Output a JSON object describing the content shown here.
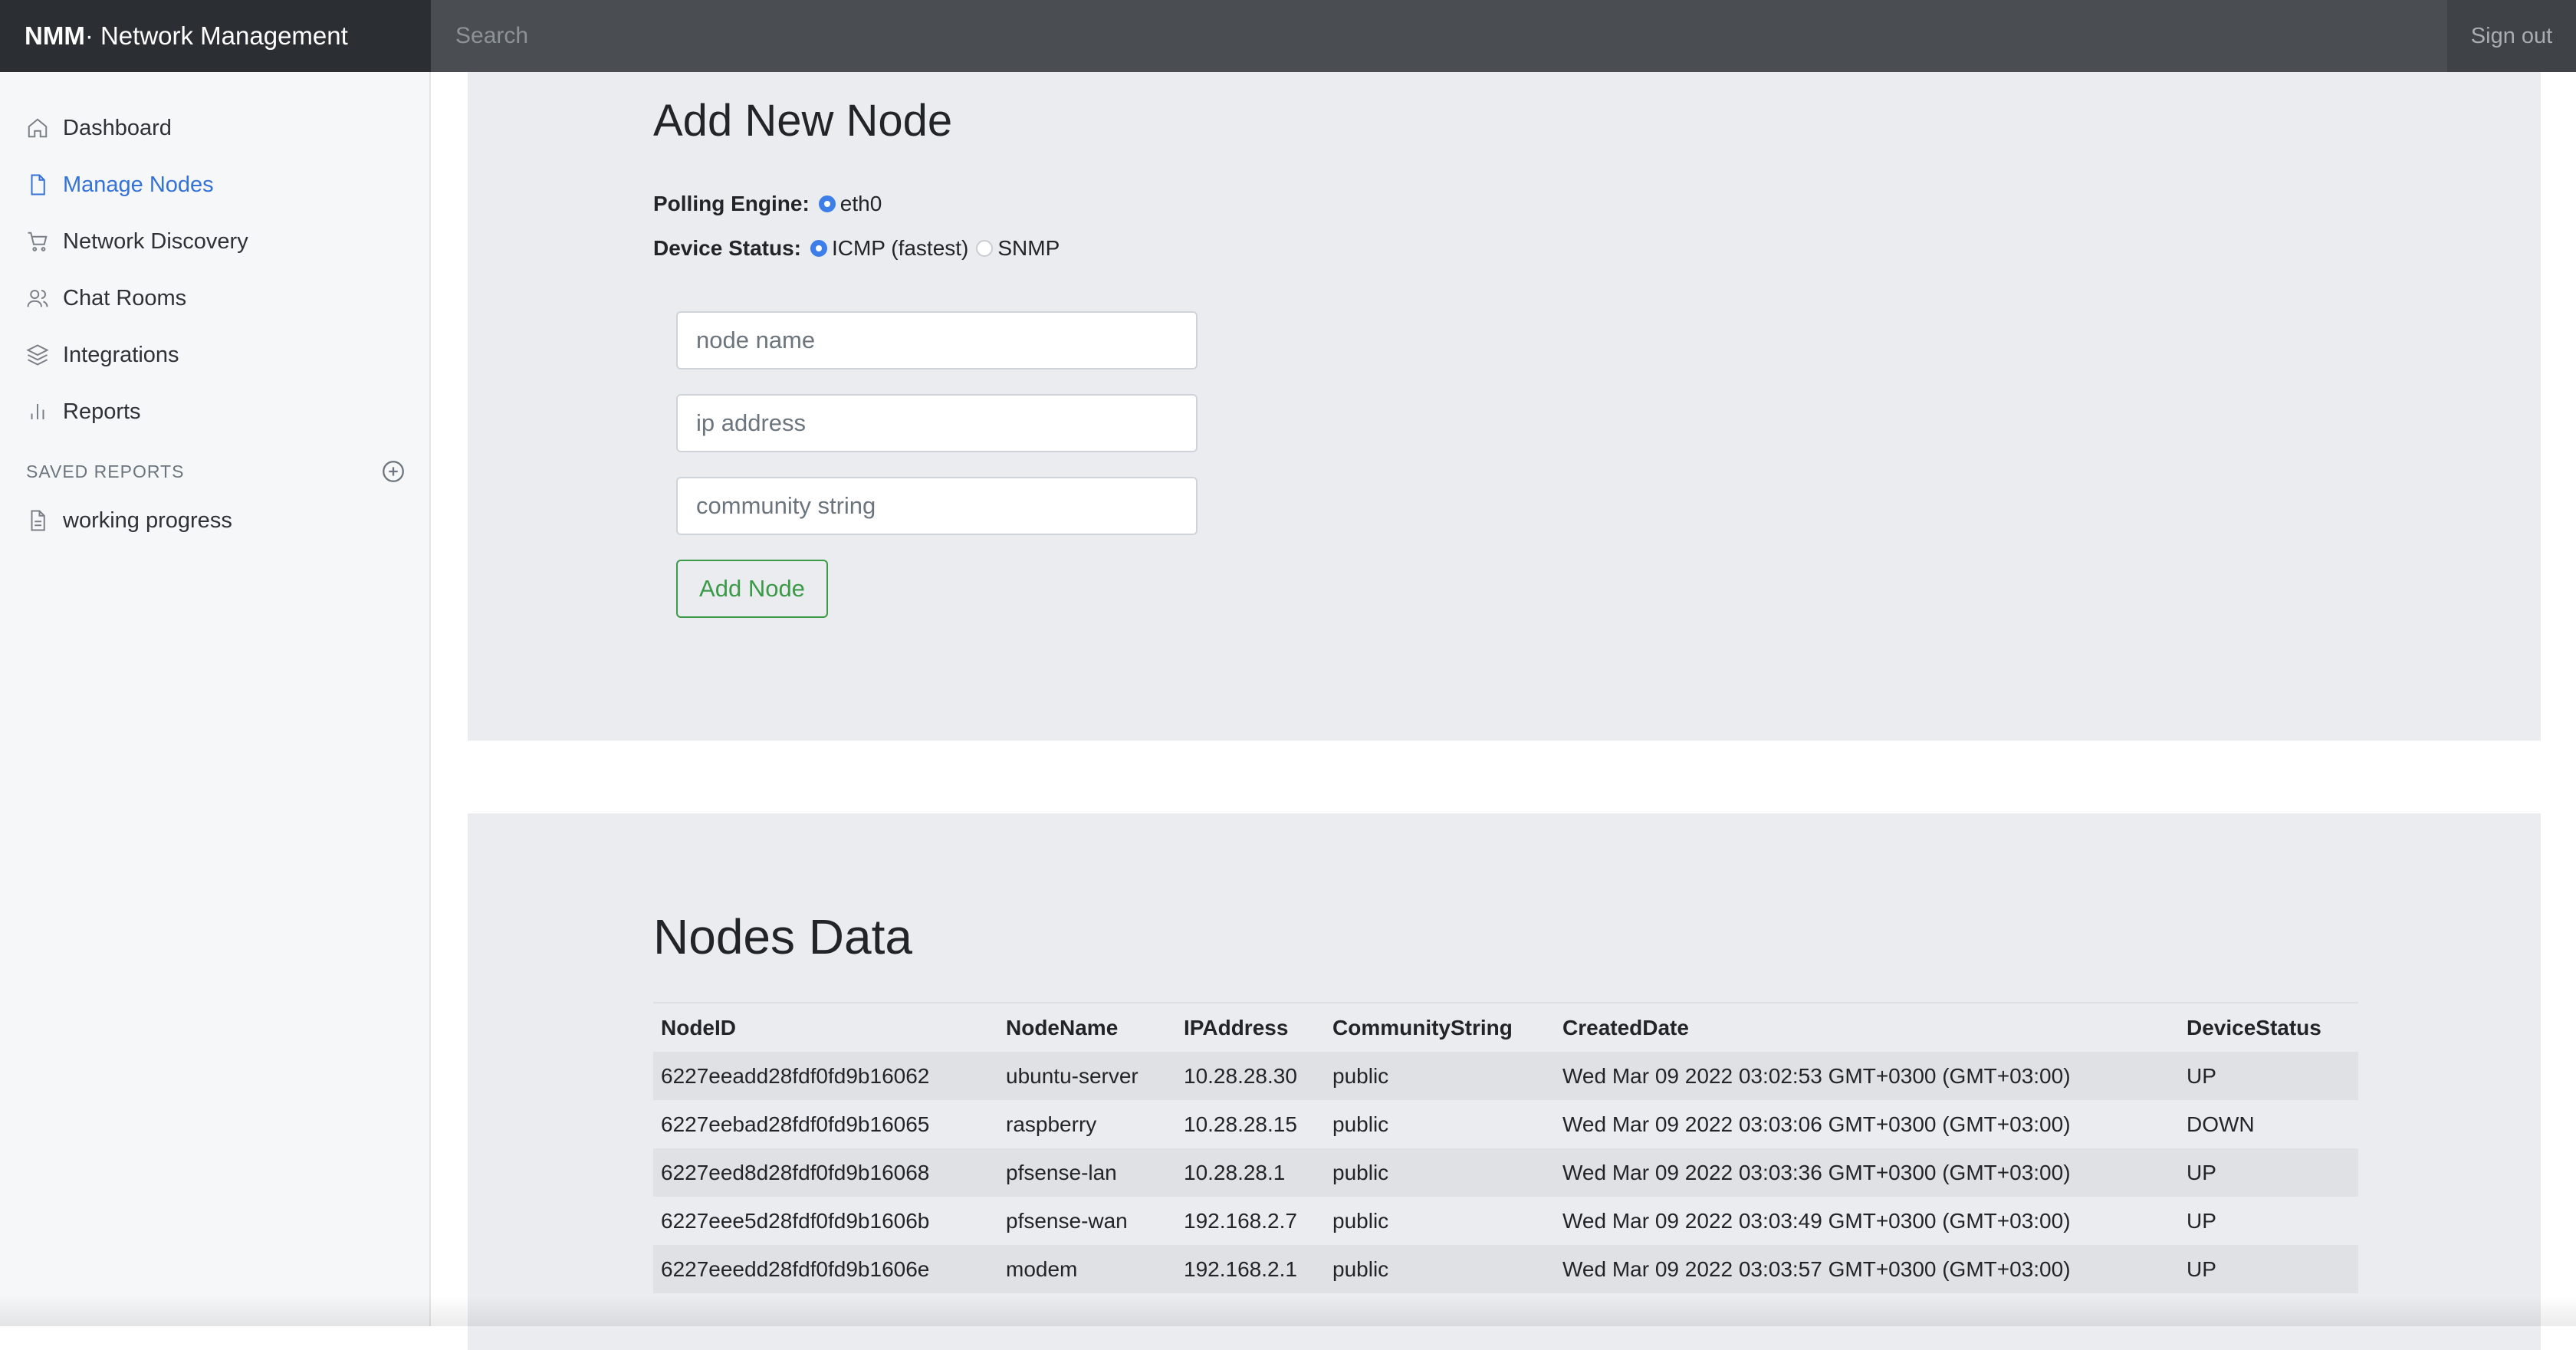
{
  "header": {
    "brand_bold": "NMM",
    "brand_rest": " · Network Management",
    "search_placeholder": "Search",
    "signout_label": "Sign out"
  },
  "sidebar": {
    "items": [
      {
        "label": "Dashboard",
        "icon": "home-icon"
      },
      {
        "label": "Manage Nodes",
        "icon": "file-icon",
        "active": true
      },
      {
        "label": "Network Discovery",
        "icon": "cart-icon"
      },
      {
        "label": "Chat Rooms",
        "icon": "users-icon"
      },
      {
        "label": "Integrations",
        "icon": "layers-icon"
      },
      {
        "label": "Reports",
        "icon": "bar-chart-icon"
      }
    ],
    "saved_title": "SAVED REPORTS",
    "saved_items": [
      {
        "label": "working progress",
        "icon": "file-text-icon"
      }
    ]
  },
  "add_node": {
    "title": "Add New Node",
    "polling_label": "Polling Engine:",
    "polling_options": [
      "eth0"
    ],
    "polling_selected": "eth0",
    "status_label": "Device Status:",
    "status_options": [
      "ICMP (fastest)",
      "SNMP"
    ],
    "status_selected": "ICMP (fastest)",
    "name_placeholder": "node name",
    "ip_placeholder": "ip address",
    "community_placeholder": "community string",
    "button_label": "Add Node"
  },
  "nodes": {
    "title": "Nodes Data",
    "columns": [
      "NodeID",
      "NodeName",
      "IPAddress",
      "CommunityString",
      "CreatedDate",
      "DeviceStatus"
    ],
    "rows": [
      [
        "6227eeadd28fdf0fd9b16062",
        "ubuntu-server",
        "10.28.28.30",
        "public",
        "Wed Mar 09 2022 03:02:53 GMT+0300 (GMT+03:00)",
        "UP"
      ],
      [
        "6227eebad28fdf0fd9b16065",
        "raspberry",
        "10.28.28.15",
        "public",
        "Wed Mar 09 2022 03:03:06 GMT+0300 (GMT+03:00)",
        "DOWN"
      ],
      [
        "6227eed8d28fdf0fd9b16068",
        "pfsense-lan",
        "10.28.28.1",
        "public",
        "Wed Mar 09 2022 03:03:36 GMT+0300 (GMT+03:00)",
        "UP"
      ],
      [
        "6227eee5d28fdf0fd9b1606b",
        "pfsense-wan",
        "192.168.2.7",
        "public",
        "Wed Mar 09 2022 03:03:49 GMT+0300 (GMT+03:00)",
        "UP"
      ],
      [
        "6227eeedd28fdf0fd9b1606e",
        "modem",
        "192.168.2.1",
        "public",
        "Wed Mar 09 2022 03:03:57 GMT+0300 (GMT+03:00)",
        "UP"
      ]
    ]
  },
  "colors": {
    "accent": "#3572d6",
    "success": "#3a9a48",
    "topbar": "#4a4e53",
    "brand_bg": "#2b2f33"
  }
}
